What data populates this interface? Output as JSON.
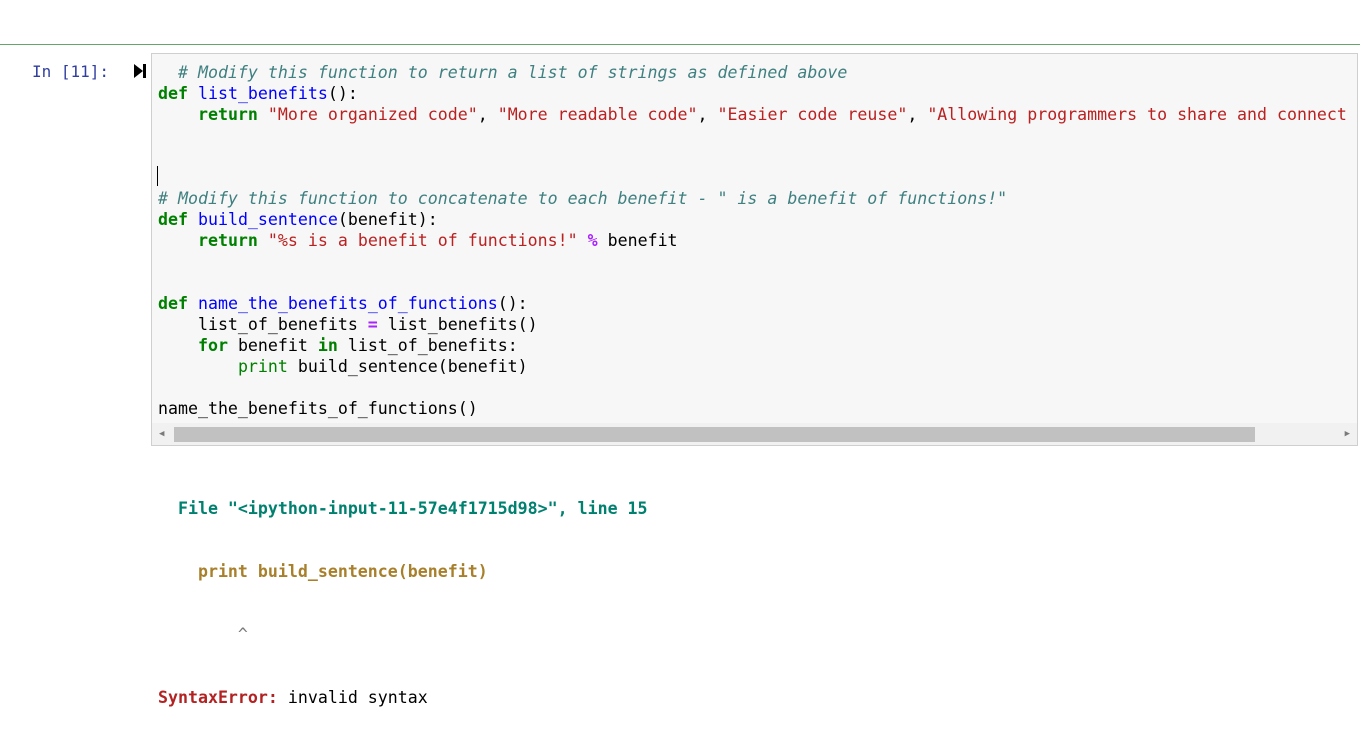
{
  "cell": {
    "prompt": "In [11]:",
    "code_lines": [
      [
        {
          "t": "  "
        },
        {
          "c": "cm",
          "t": "# Modify this function to return a list of strings as defined above"
        }
      ],
      [
        {
          "c": "kw",
          "t": "def"
        },
        {
          "t": " "
        },
        {
          "c": "fn",
          "t": "list_benefits"
        },
        {
          "t": "():"
        }
      ],
      [
        {
          "t": "    "
        },
        {
          "c": "kw",
          "t": "return"
        },
        {
          "t": " "
        },
        {
          "c": "str",
          "t": "\"More organized code\""
        },
        {
          "t": ", "
        },
        {
          "c": "str",
          "t": "\"More readable code\""
        },
        {
          "t": ", "
        },
        {
          "c": "str",
          "t": "\"Easier code reuse\""
        },
        {
          "t": ", "
        },
        {
          "c": "str",
          "t": "\"Allowing programmers to share and connect code"
        }
      ],
      [
        {
          "t": ""
        }
      ],
      [
        {
          "t": ""
        }
      ],
      [
        {
          "t": ""
        }
      ],
      [
        {
          "c": "cm",
          "t": "# Modify this function to concatenate to each benefit - \" is a benefit of functions!\""
        }
      ],
      [
        {
          "c": "kw",
          "t": "def"
        },
        {
          "t": " "
        },
        {
          "c": "fn",
          "t": "build_sentence"
        },
        {
          "t": "(benefit):"
        }
      ],
      [
        {
          "t": "    "
        },
        {
          "c": "kw",
          "t": "return"
        },
        {
          "t": " "
        },
        {
          "c": "str",
          "t": "\"%s is a benefit of functions!\""
        },
        {
          "t": " "
        },
        {
          "c": "op",
          "t": "%"
        },
        {
          "t": " benefit"
        }
      ],
      [
        {
          "t": ""
        }
      ],
      [
        {
          "t": ""
        }
      ],
      [
        {
          "c": "kw",
          "t": "def"
        },
        {
          "t": " "
        },
        {
          "c": "fn",
          "t": "name_the_benefits_of_functions"
        },
        {
          "t": "():"
        }
      ],
      [
        {
          "t": "    list_of_benefits "
        },
        {
          "c": "op",
          "t": "="
        },
        {
          "t": " list_benefits()"
        }
      ],
      [
        {
          "t": "    "
        },
        {
          "c": "kw",
          "t": "for"
        },
        {
          "t": " benefit "
        },
        {
          "c": "kw",
          "t": "in"
        },
        {
          "t": " list_of_benefits:"
        }
      ],
      [
        {
          "t": "        "
        },
        {
          "c": "bi",
          "t": "print"
        },
        {
          "t": " build_sentence(benefit)"
        }
      ],
      [
        {
          "t": ""
        }
      ],
      [
        {
          "t": "name_the_benefits_of_functions()"
        }
      ]
    ]
  },
  "output": {
    "file_line": "  File \"<ipython-input-11-57e4f1715d98>\", line 15",
    "code_line": "    print build_sentence(benefit)",
    "caret": "        ^",
    "error_name": "SyntaxError:",
    "error_msg": " invalid syntax"
  },
  "scrollbar": {
    "left_arrow": "◀",
    "right_arrow": "▶"
  }
}
